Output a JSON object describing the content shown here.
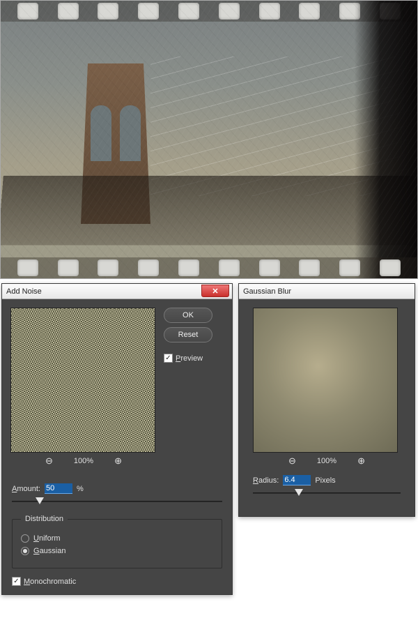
{
  "noise_dialog": {
    "title": "Add Noise",
    "ok_label": "OK",
    "reset_label": "Reset",
    "preview_label": "Preview",
    "preview_checked": true,
    "zoom_value": "100%",
    "amount_label": "Amount:",
    "amount_value": "50",
    "amount_unit": "%",
    "distribution_label": "Distribution",
    "uniform_label": "Uniform",
    "gaussian_label": "Gaussian",
    "selected_distribution": "Gaussian",
    "monochromatic_label": "Monochromatic",
    "monochromatic_checked": true
  },
  "blur_dialog": {
    "title": "Gaussian Blur",
    "zoom_value": "100%",
    "radius_label": "Radius:",
    "radius_value": "6.4",
    "radius_unit": "Pixels"
  }
}
